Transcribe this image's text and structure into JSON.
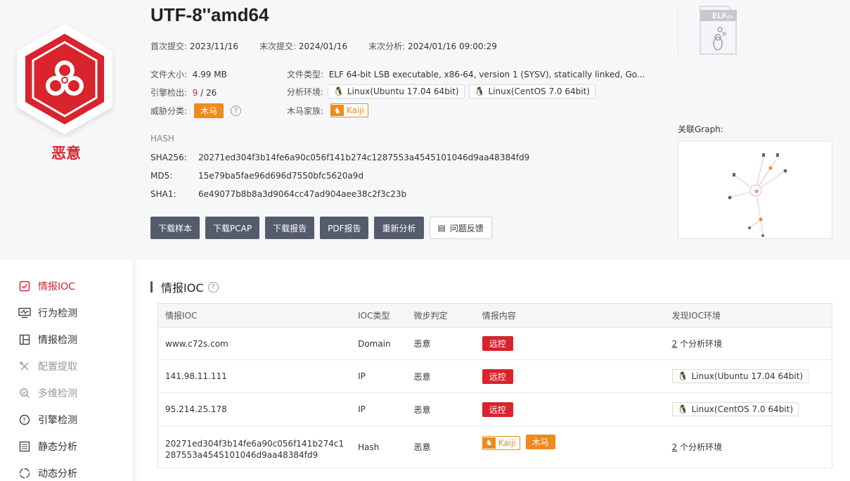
{
  "file": {
    "name": "UTF-8''amd64",
    "first_submit_label": "首次提交:",
    "first_submit": "2023/11/16",
    "last_submit_label": "末次提交:",
    "last_submit": "2024/01/16",
    "last_analysis_label": "末次分析:",
    "last_analysis": "2024/01/16 09:00:29",
    "size_label": "文件大小:",
    "size": "4.99 MB",
    "engine_label": "引擎检出:",
    "engine_hits": "9",
    "engine_total": "/ 26",
    "threat_label": "威胁分类:",
    "threat": "木马",
    "type_label": "文件类型:",
    "type": "ELF 64-bit LSB executable, x86-64, version 1 (SYSV), statically linked, Go...",
    "env_label": "分析环境:",
    "envs": [
      "Linux(Ubuntu 17.04 64bit)",
      "Linux(CentOS 7.0 64bit)"
    ],
    "family_label": "木马家族:",
    "family": "Kaiji"
  },
  "verdict": {
    "label": "恶意",
    "color": "#d9232d"
  },
  "hash": {
    "title": "HASH",
    "sha256_label": "SHA256:",
    "sha256": "20271ed304f3b14fe6a90c056f141b274c1287553a4545101046d9aa48384fd9",
    "md5_label": "MD5:",
    "md5": "15e79ba5fae96d696d7550bfc5620a9d",
    "sha1_label": "SHA1:",
    "sha1": "6e49077b8b8a3d9064cc47ad904aee38c2f3c23b"
  },
  "buttons": [
    "下载样本",
    "下载PCAP",
    "下载报告",
    "PDF报告",
    "重新分析",
    "问题反馈"
  ],
  "elf_badge": {
    "main": "ELF",
    "sub": "x64"
  },
  "graph_label": "关联Graph:",
  "sidebar": [
    {
      "label": "情报IOC",
      "icon": "checklist-icon",
      "state": "active"
    },
    {
      "label": "行为检测",
      "icon": "monitor-pulse-icon",
      "state": "normal"
    },
    {
      "label": "情报检测",
      "icon": "layout-icon",
      "state": "normal"
    },
    {
      "label": "配置提取",
      "icon": "tools-icon",
      "state": "disabled"
    },
    {
      "label": "多维检测",
      "icon": "scan-icon",
      "state": "disabled"
    },
    {
      "label": "引擎检测",
      "icon": "engine-icon",
      "state": "normal"
    },
    {
      "label": "静态分析",
      "icon": "list-icon",
      "state": "normal"
    },
    {
      "label": "动态分析",
      "icon": "dynamic-icon",
      "state": "normal"
    }
  ],
  "ioc_section": {
    "title": "情报IOC",
    "columns": [
      "情报IOC",
      "IOC类型",
      "微步判定",
      "情报内容",
      "发现IOC环境"
    ],
    "rows": [
      {
        "ioc": "www.c72s.com",
        "type": "Domain",
        "verdict": "恶意",
        "content": "远控",
        "env_count": "2",
        "env_suffix": "个分析环境"
      },
      {
        "ioc": "141.98.11.111",
        "type": "IP",
        "verdict": "恶意",
        "content": "远控",
        "env": "Linux(Ubuntu 17.04 64bit)"
      },
      {
        "ioc": "95.214.25.178",
        "type": "IP",
        "verdict": "恶意",
        "content": "远控",
        "env": "Linux(CentOS 7.0 64bit)"
      },
      {
        "ioc_line1": "20271ed304f3b14fe6a90c056f141b274c1",
        "ioc_line2": "287553a4545101046d9aa48384fd9",
        "type": "Hash",
        "verdict": "恶意",
        "family": "Kaiji",
        "threat": "木马",
        "env_count": "2",
        "env_suffix": "个分析环境"
      }
    ]
  }
}
